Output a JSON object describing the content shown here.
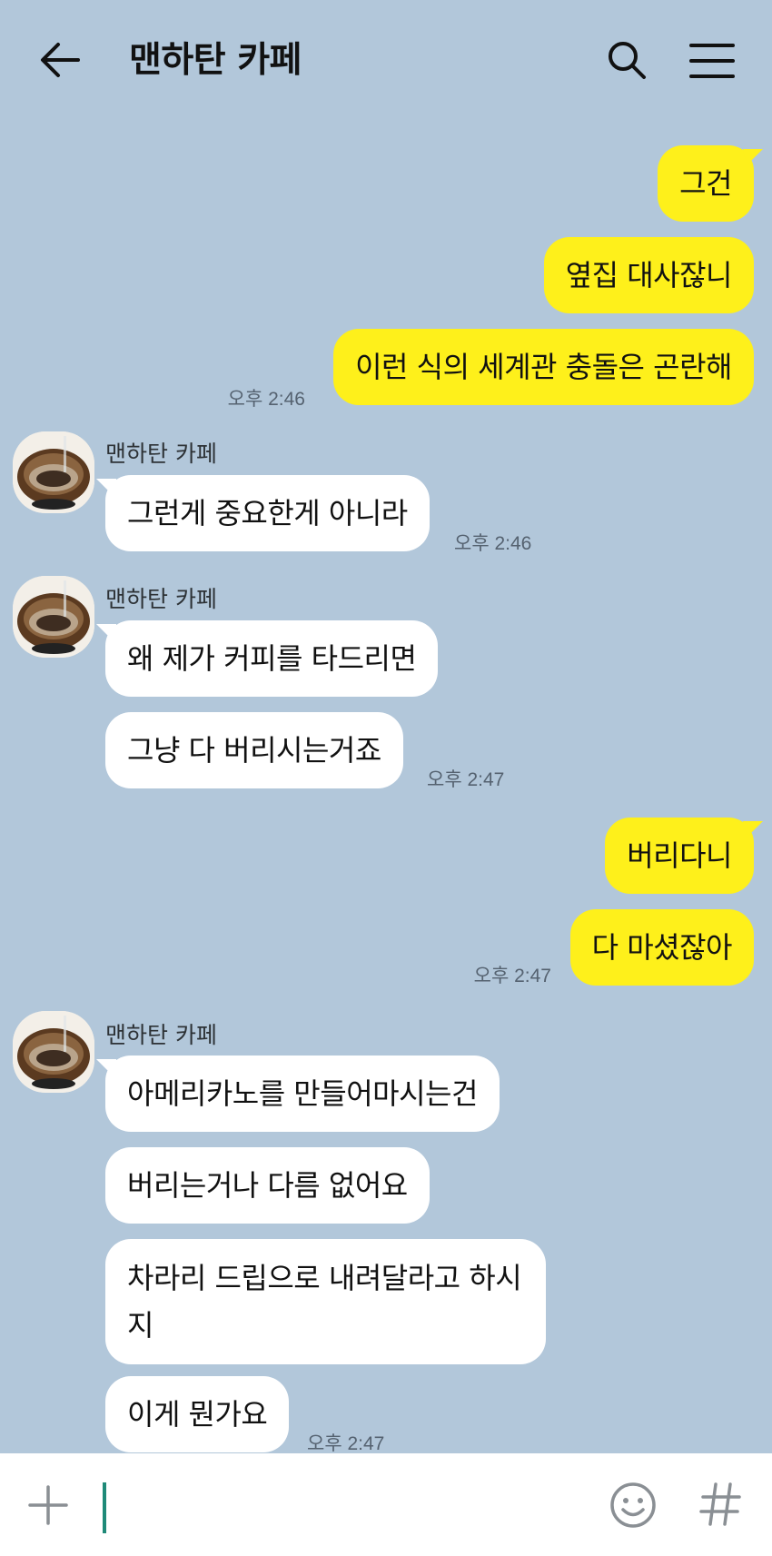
{
  "header": {
    "title": "맨하탄 카페",
    "icons": [
      "back-arrow-icon",
      "search-icon",
      "menu-icon"
    ]
  },
  "messages": [
    {
      "sender": "me",
      "text": "그건"
    },
    {
      "sender": "me",
      "text": "옆집 대사잖니"
    },
    {
      "sender": "me",
      "text": "이런 식의 세계관 충돌은 곤란해",
      "time": "오후 2:46"
    },
    {
      "sender": "them",
      "name": "맨하탄 카페",
      "text": "그런게 중요한게 아니라",
      "time": "오후 2:46"
    },
    {
      "sender": "them",
      "name": "맨하탄 카페",
      "text": "왜 제가 커피를 타드리면"
    },
    {
      "sender": "them",
      "text": "그냥 다 버리시는거죠",
      "time": "오후 2:47"
    },
    {
      "sender": "me",
      "text": "버리다니"
    },
    {
      "sender": "me",
      "text": "다 마셨잖아",
      "time": "오후 2:47"
    },
    {
      "sender": "them",
      "name": "맨하탄 카페",
      "text": "아메리카노를 만들어마시는건"
    },
    {
      "sender": "them",
      "text": "버리는거나 다름 없어요"
    },
    {
      "sender": "them",
      "text": "차라리 드립으로 내려달라고 하시지"
    },
    {
      "sender": "them",
      "text": "이게 뭔가요",
      "time": "오후 2:47"
    }
  ],
  "input": {
    "value": "",
    "placeholder": "",
    "icons": [
      "plus-icon",
      "emoji-icon",
      "hashtag-icon"
    ]
  },
  "colors": {
    "background": "#b2c7da",
    "my_bubble": "#fef01b",
    "their_bubble": "#ffffff",
    "cursor": "#1f8a78"
  }
}
